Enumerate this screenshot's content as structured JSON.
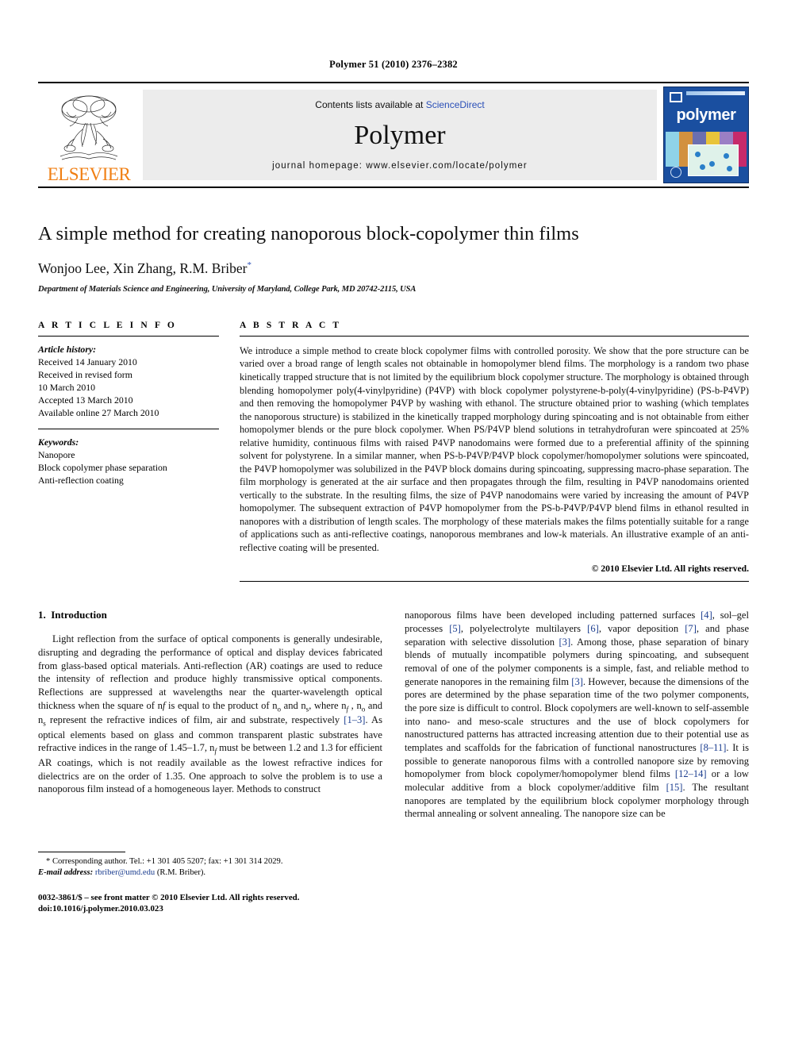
{
  "running_head": "Polymer 51 (2010) 2376–2382",
  "banner": {
    "publisher_name": "ELSEVIER",
    "contents_prefix": "Contents lists available at ",
    "sciencedirect": "ScienceDirect",
    "journal_name": "Polymer",
    "homepage": "journal homepage: www.elsevier.com/locate/polymer",
    "cover_title": "polymer",
    "link_color": "#2a4fb7",
    "cover_bg": "#1a4fa0",
    "elsevier_orange": "#f07f13"
  },
  "title": "A simple method for creating nanoporous block-copolymer thin films",
  "authors": "Wonjoo Lee, Xin Zhang, R.M. Briber",
  "author_marker": "*",
  "affiliation": "Department of Materials Science and Engineering, University of Maryland, College Park, MD 20742-2115, USA",
  "article_info": {
    "heading": "A R T I C L E   I N F O",
    "history_label": "Article history:",
    "history": [
      "Received 14 January 2010",
      "Received in revised form",
      "10 March 2010",
      "Accepted 13 March 2010",
      "Available online 27 March 2010"
    ],
    "keywords_label": "Keywords:",
    "keywords": [
      "Nanopore",
      "Block copolymer phase separation",
      "Anti-reflection coating"
    ]
  },
  "abstract": {
    "heading": "A B S T R A C T",
    "text": "We introduce a simple method to create block copolymer films with controlled porosity. We show that the pore structure can be varied over a broad range of length scales not obtainable in homopolymer blend films. The morphology is a random two phase kinetically trapped structure that is not limited by the equilibrium block copolymer structure. The morphology is obtained through blending homopolymer poly(4-vinylpyridine) (P4VP) with block copolymer polystyrene-b-poly(4-vinylpyridine) (PS-b-P4VP) and then removing the homopolymer P4VP by washing with ethanol. The structure obtained prior to washing (which templates the nanoporous structure) is stabilized in the kinetically trapped morphology during spincoating and is not obtainable from either homopolymer blends or the pure block copolymer. When PS/P4VP blend solutions in tetrahydrofuran were spincoated at 25% relative humidity, continuous films with raised P4VP nanodomains were formed due to a preferential affinity of the spinning solvent for polystyrene. In a similar manner, when PS-b-P4VP/P4VP block copolymer/homopolymer solutions were spincoated, the P4VP homopolymer was solubilized in the P4VP block domains during spincoating, suppressing macro-phase separation. The film morphology is generated at the air surface and then propagates through the film, resulting in P4VP nanodomains oriented vertically to the substrate. In the resulting films, the size of P4VP nanodomains were varied by increasing the amount of P4VP homopolymer. The subsequent extraction of P4VP homopolymer from the PS-b-P4VP/P4VP blend films in ethanol resulted in nanopores with a distribution of length scales. The morphology of these materials makes the films potentially suitable for a range of applications such as anti-reflective coatings, nanoporous membranes and low-k materials. An illustrative example of an anti-reflective coating will be presented.",
    "copyright": "© 2010 Elsevier Ltd. All rights reserved."
  },
  "introduction": {
    "section_number": "1.",
    "section_title": "Introduction",
    "left_paragraph_part1": "Light reflection from the surface of optical components is generally undesirable, disrupting and degrading the performance of optical and display devices fabricated from glass-based optical materials. Anti-reflection (AR) coatings are used to reduce the intensity of reflection and produce highly transmissive optical components. Reflections are suppressed at wavelengths near the quarter-wavelength optical thickness when the square of n",
    "left_paragraph_part2": " is equal to the product of n",
    "left_paragraph_part3": " and n",
    "left_paragraph_part4": ", where n",
    "left_paragraph_part5": " , n",
    "left_paragraph_part6": " and n",
    "left_paragraph_part7": " represent the refractive indices of film, air and substrate, respectively ",
    "ref_1_3": "[1–3]",
    "left_paragraph_part8": ". As optical elements based on glass and common transparent plastic substrates have refractive indices in the range of 1.45–1.7, n",
    "left_paragraph_part9": " must be between 1.2 and 1.3 for efficient AR coatings, which is not readily available as the lowest refractive indices for dielectrics are on the order of 1.35. One approach to solve the problem is to use a nanoporous film instead of a homogeneous layer. Methods to construct",
    "sub_f": "f",
    "sub_o": "o",
    "sub_s": "s",
    "right_part1": "nanoporous films have been developed including patterned surfaces ",
    "ref_4": "[4]",
    "right_part2": ", sol–gel processes ",
    "ref_5": "[5]",
    "right_part3": ", polyelectrolyte multilayers ",
    "ref_6": "[6]",
    "right_part4": ", vapor deposition ",
    "ref_7": "[7]",
    "right_part5": ", and phase separation with selective dissolution ",
    "ref_3a": "[3]",
    "right_part6": ". Among those, phase separation of binary blends of mutually incompatible polymers during spincoating, and subsequent removal of one of the polymer components is a simple, fast, and reliable method to generate nanopores in the remaining film ",
    "ref_3b": "[3]",
    "right_part7": ". However, because the dimensions of the pores are determined by the phase separation time of the two polymer components, the pore size is difficult to control. Block copolymers are well-known to self-assemble into nano- and meso-scale structures and the use of block copolymers for nanostructured patterns has attracted increasing attention due to their potential use as templates and scaffolds for the fabrication of functional nanostructures ",
    "ref_8_11": "[8–11]",
    "right_part8": ". It is possible to generate nanoporous films with a controlled nanopore size by removing homopolymer from block copolymer/homopolymer blend films ",
    "ref_12_14": "[12–14]",
    "right_part9": " or a low molecular additive from a block copolymer/additive film ",
    "ref_15": "[15]",
    "right_part10": ". The resultant nanopores are templated by the equilibrium block copolymer morphology through thermal annealing or solvent annealing. The nanopore size can be"
  },
  "footnote": {
    "marker": "*",
    "corresponding": " Corresponding author. Tel.: +1 301 405 5207; fax: +1 301 314 2029.",
    "email_label": "E-mail address:",
    "email": "rbriber@umd.edu",
    "email_suffix": " (R.M. Briber)."
  },
  "issn_line1": "0032-3861/$ – see front matter © 2010 Elsevier Ltd. All rights reserved.",
  "issn_line2": "doi:10.1016/j.polymer.2010.03.023"
}
